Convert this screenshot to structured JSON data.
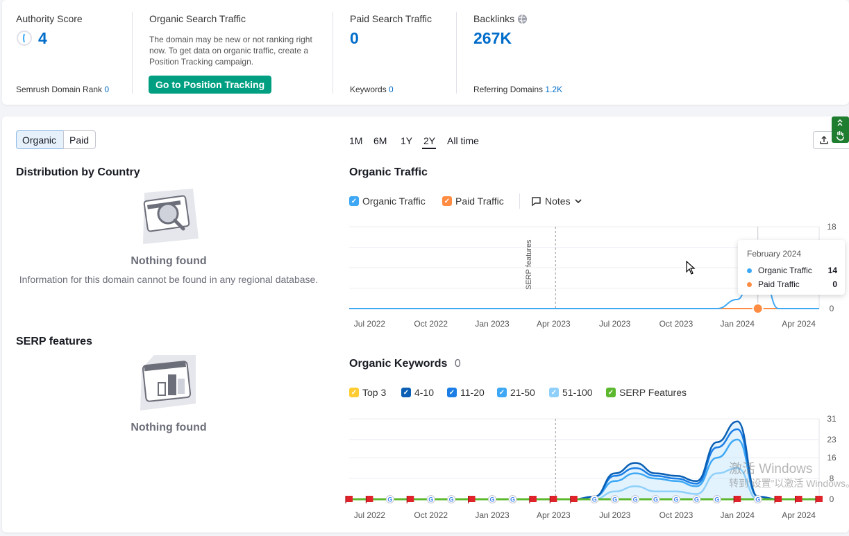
{
  "summary": {
    "authority": {
      "label": "Authority Score",
      "value": "4",
      "rank_label": "Semrush Domain Rank",
      "rank_value": "0"
    },
    "organic": {
      "label": "Organic Search Traffic",
      "description": "The domain may be new or not ranking right now. To get data on organic traffic, create a Position Tracking campaign.",
      "button": "Go to Position Tracking"
    },
    "paid": {
      "label": "Paid Search Traffic",
      "value": "0",
      "keywords_label": "Keywords",
      "keywords_value": "0"
    },
    "backlinks": {
      "label": "Backlinks",
      "value": "267K",
      "ref_label": "Referring Domains",
      "ref_value": "1.2K"
    }
  },
  "toggle": {
    "organic": "Organic",
    "paid": "Paid"
  },
  "ranges": [
    "1M",
    "6M",
    "1Y",
    "2Y",
    "All time"
  ],
  "ranges_active": "2Y",
  "distribution": {
    "title": "Distribution by Country",
    "empty_title": "Nothing found",
    "empty_text": "Information for this domain cannot be found in any regional database."
  },
  "serp": {
    "title": "SERP features",
    "empty_title": "Nothing found"
  },
  "traffic": {
    "title": "Organic Traffic",
    "legend": [
      {
        "label": "Organic Traffic",
        "color": "#3ea8f5"
      },
      {
        "label": "Paid Traffic",
        "color": "#ff8c43"
      }
    ],
    "notes": "Notes",
    "annotation": "SERP features",
    "tooltip": {
      "date": "February 2024",
      "rows": [
        {
          "label": "Organic Traffic",
          "value": "14",
          "color": "#3ea8f5"
        },
        {
          "label": "Paid Traffic",
          "value": "0",
          "color": "#ff8c43"
        }
      ]
    }
  },
  "keywords": {
    "title": "Organic Keywords",
    "count": "0",
    "legend": [
      {
        "label": "Top 3",
        "color": "#ffcc33"
      },
      {
        "label": "4-10",
        "color": "#0a5fb4"
      },
      {
        "label": "11-20",
        "color": "#1a7ee6"
      },
      {
        "label": "21-50",
        "color": "#3ea8f5"
      },
      {
        "label": "51-100",
        "color": "#8fd0fb"
      },
      {
        "label": "SERP Features",
        "color": "#5cb82e"
      }
    ]
  },
  "watermark": {
    "line1": "激活 Windows",
    "line2": "转到“设置”以激活 Windows。"
  },
  "chart_data": [
    {
      "type": "line",
      "title": "Organic Traffic",
      "x": [
        "2022-06",
        "2022-07",
        "2022-08",
        "2022-09",
        "2022-10",
        "2022-11",
        "2022-12",
        "2023-01",
        "2023-02",
        "2023-03",
        "2023-04",
        "2023-05",
        "2023-06",
        "2023-07",
        "2023-08",
        "2023-09",
        "2023-10",
        "2023-11",
        "2023-12",
        "2024-01",
        "2024-02",
        "2024-03",
        "2024-04",
        "2024-05"
      ],
      "x_ticks": [
        "Jul 2022",
        "Oct 2022",
        "Jan 2023",
        "Apr 2023",
        "Jul 2023",
        "Oct 2023",
        "Jan 2024",
        "Apr 2024"
      ],
      "series": [
        {
          "name": "Organic Traffic",
          "color": "#3ea8f5",
          "values": [
            0,
            0,
            0,
            0,
            0,
            0,
            0,
            0,
            0,
            0,
            0,
            0,
            0,
            0,
            0,
            0,
            0,
            0,
            0,
            2,
            14,
            0,
            0,
            0
          ]
        },
        {
          "name": "Paid Traffic",
          "color": "#ff8c43",
          "values": [
            0,
            0,
            0,
            0,
            0,
            0,
            0,
            0,
            0,
            0,
            0,
            0,
            0,
            0,
            0,
            0,
            0,
            0,
            0,
            0,
            0,
            0,
            0,
            0
          ]
        }
      ],
      "y_ticks": [
        0,
        18
      ],
      "ylim": [
        0,
        18
      ],
      "grid": true
    },
    {
      "type": "area",
      "title": "Organic Keywords",
      "x": [
        "2022-06",
        "2022-07",
        "2022-08",
        "2022-09",
        "2022-10",
        "2022-11",
        "2022-12",
        "2023-01",
        "2023-02",
        "2023-03",
        "2023-04",
        "2023-05",
        "2023-06",
        "2023-07",
        "2023-08",
        "2023-09",
        "2023-10",
        "2023-11",
        "2023-12",
        "2024-01",
        "2024-02",
        "2024-03",
        "2024-04",
        "2024-05"
      ],
      "x_ticks": [
        "Jul 2022",
        "Oct 2022",
        "Jan 2023",
        "Apr 2023",
        "Jul 2023",
        "Oct 2023",
        "Jan 2024",
        "Apr 2024"
      ],
      "series": [
        {
          "name": "4-10",
          "color": "#0a5fb4",
          "values": [
            0,
            0,
            0,
            0,
            0,
            0,
            0,
            0,
            0,
            0,
            0,
            0,
            1,
            10,
            14,
            10,
            9,
            7,
            22,
            30,
            1,
            0,
            0,
            0
          ]
        },
        {
          "name": "11-20",
          "color": "#1a7ee6",
          "values": [
            0,
            0,
            0,
            0,
            0,
            0,
            0,
            0,
            0,
            0,
            0,
            0,
            1,
            9,
            12,
            9,
            8,
            6,
            20,
            27,
            1,
            0,
            0,
            0
          ]
        },
        {
          "name": "21-50",
          "color": "#3ea8f5",
          "values": [
            0,
            0,
            0,
            0,
            0,
            0,
            0,
            0,
            0,
            0,
            0,
            0,
            1,
            7,
            10,
            8,
            7,
            5,
            16,
            23,
            1,
            0,
            0,
            0
          ]
        },
        {
          "name": "51-100",
          "color": "#8fd0fb",
          "values": [
            0,
            0,
            0,
            0,
            0,
            0,
            0,
            0,
            0,
            0,
            0,
            0,
            0,
            3,
            5,
            3,
            3,
            2,
            10,
            12,
            0,
            0,
            0,
            0
          ]
        }
      ],
      "y_ticks": [
        0,
        8,
        16,
        23,
        31
      ],
      "ylim": [
        0,
        31
      ],
      "grid": true
    }
  ]
}
